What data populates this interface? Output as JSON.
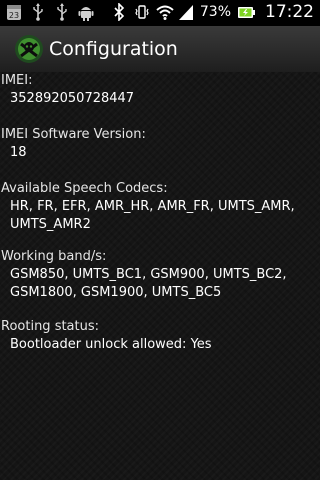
{
  "status_bar": {
    "left_icons": [
      "calendar-icon",
      "usb-icon",
      "usb-icon",
      "android-icon"
    ],
    "bluetooth_icon": "bluetooth-icon",
    "vibrate_icon": "vibrate-icon",
    "wifi_icon": "wifi-icon",
    "signal_icon": "signal-icon",
    "battery_percent": "73%",
    "battery_icon": "battery-charging-icon",
    "time": "17:22",
    "calendar_day": "23"
  },
  "header": {
    "title": "Configuration"
  },
  "sections": [
    {
      "label": "IMEI:",
      "value": "352892050728447"
    },
    {
      "label": "IMEI Software Version:",
      "value": "18"
    },
    {
      "label": "Available Speech Codecs:",
      "value": "HR, FR, EFR, AMR_HR, AMR_FR, UMTS_AMR,\nUMTS_AMR2"
    },
    {
      "label": "Working band/s:",
      "value": "GSM850, UMTS_BC1, GSM900, UMTS_BC2,\nGSM1800, GSM1900, UMTS_BC5"
    },
    {
      "label": "Rooting status:",
      "value": "Bootloader unlock allowed: Yes"
    }
  ],
  "colors": {
    "status_bar_bg": "#000000",
    "title_bar_bg": "#2a2a2a",
    "content_bg": "#151515",
    "text": "#ffffff",
    "battery_green": "#7ed321"
  }
}
